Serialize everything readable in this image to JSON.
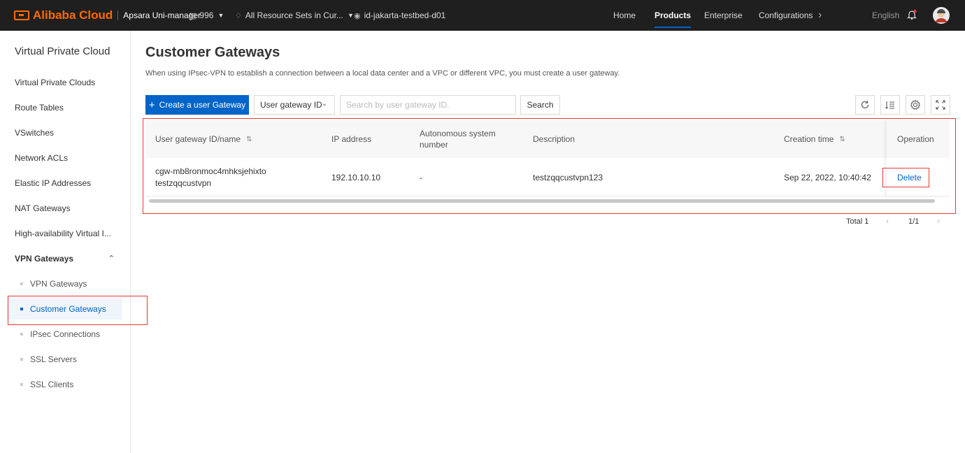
{
  "topbar": {
    "brand": "Alibaba Cloud",
    "app_name": "Apsara Uni-manager",
    "org_id": "996",
    "resource_set": "All Resource Sets in Cur...",
    "region": "id-jakarta-testbed-d01",
    "nav": [
      {
        "label": "Home",
        "active": false
      },
      {
        "label": "Products",
        "active": true
      },
      {
        "label": "Enterprise",
        "active": false
      },
      {
        "label": "Configurations",
        "active": false
      }
    ],
    "language": "English"
  },
  "sidebar": {
    "title": "Virtual Private Cloud",
    "items": [
      {
        "label": "Virtual Private Clouds"
      },
      {
        "label": "Route Tables"
      },
      {
        "label": "VSwitches"
      },
      {
        "label": "Network ACLs"
      },
      {
        "label": "Elastic IP Addresses"
      },
      {
        "label": "NAT Gateways"
      },
      {
        "label": "High-availability Virtual I..."
      },
      {
        "label": "VPN Gateways"
      }
    ],
    "subitems": [
      {
        "label": "VPN Gateways",
        "active": false
      },
      {
        "label": "Customer Gateways",
        "active": true
      },
      {
        "label": "IPsec Connections",
        "active": false
      },
      {
        "label": "SSL Servers",
        "active": false
      },
      {
        "label": "SSL Clients",
        "active": false
      }
    ]
  },
  "main": {
    "title": "Customer Gateways",
    "description": "When using IPsec-VPN to establish a connection between a local data center and a VPC or different VPC, you must create a user gateway.",
    "create_button": "Create a user Gateway",
    "filter_select": "User gateway ID",
    "search_placeholder": "Search by user gateway ID.",
    "search_button": "Search"
  },
  "table": {
    "columns": [
      "User gateway ID/name",
      "IP address",
      "Autonomous system number",
      "Description",
      "Creation time",
      "Operation"
    ],
    "rows": [
      {
        "id": "cgw-mb8ronmoc4mhksjehixto",
        "name": "testzqqcustvpn",
        "ip": "192.10.10.10",
        "asn": "-",
        "description": "testzqqcustvpn123",
        "created": "Sep 22, 2022, 10:40:42",
        "operation": "Delete"
      }
    ]
  },
  "pagination": {
    "total": "Total 1",
    "page": "1/1"
  },
  "colors": {
    "primary": "#0064c8",
    "brand": "#ff6a00",
    "annotation": "#e53935",
    "topbar_bg": "#1f1f1f"
  }
}
